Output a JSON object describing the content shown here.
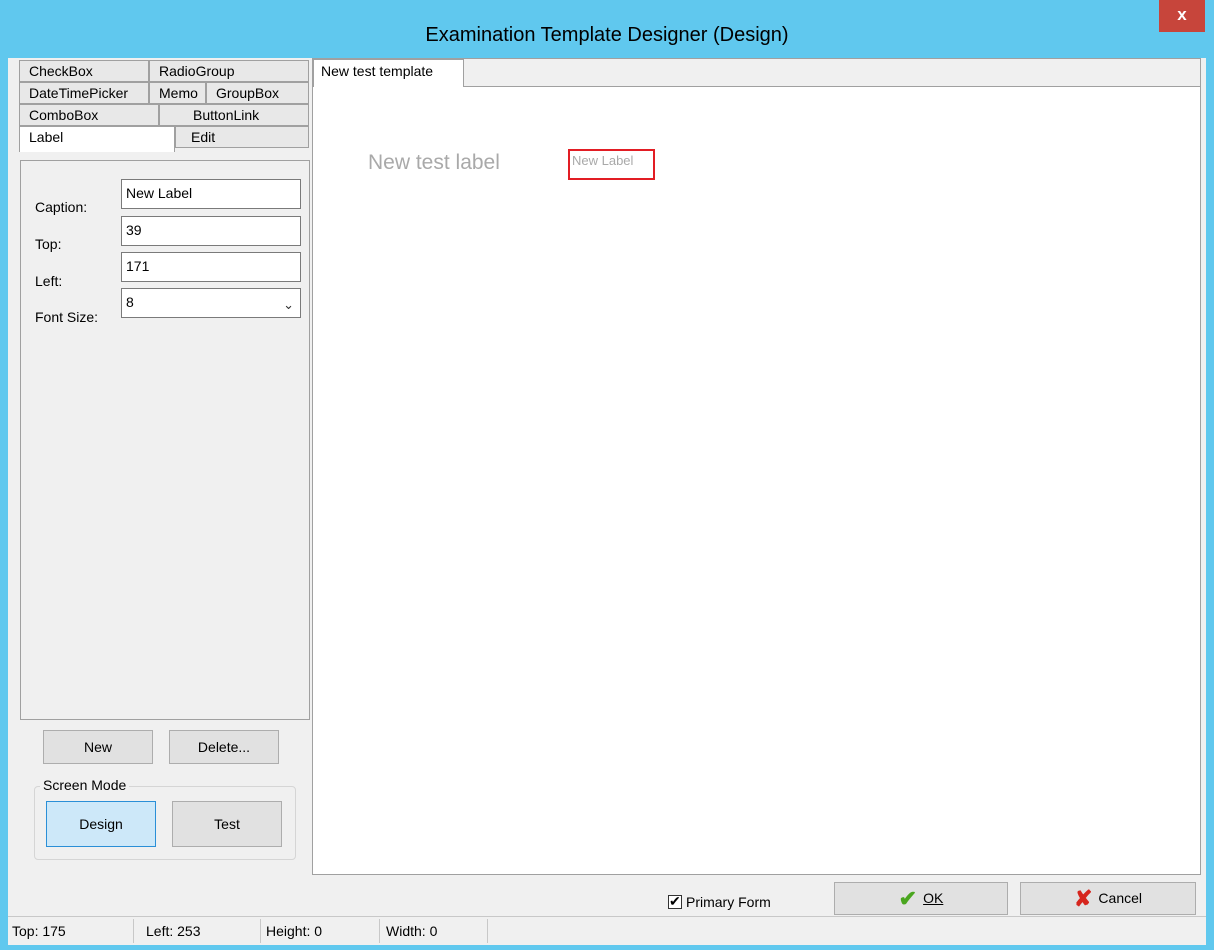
{
  "window": {
    "title": "Examination Template Designer (Design)",
    "close_glyph": "x"
  },
  "palette_tabs": [
    "CheckBox",
    "RadioGroup",
    "DateTimePicker",
    "Memo",
    "GroupBox",
    "ComboBox",
    "ButtonLink",
    "Label",
    "Edit"
  ],
  "properties": {
    "caption_label": "Caption:",
    "caption_value": "New Label",
    "top_label": "Top:",
    "top_value": "39",
    "left_label": "Left:",
    "left_value": "171",
    "fontsize_label": "Font Size:",
    "fontsize_value": "8"
  },
  "buttons": {
    "new": "New",
    "delete": "Delete..."
  },
  "screen_mode": {
    "caption": "Screen Mode",
    "design": "Design",
    "test": "Test",
    "selected": "Design"
  },
  "designer": {
    "tab": "New test template",
    "canvas_label_text": "New test label",
    "selected_label_text": "New Label"
  },
  "footer": {
    "primary_form_label": "Primary Form",
    "primary_form_checked": true,
    "ok_label": "OK",
    "cancel_label": "Cancel"
  },
  "status": {
    "top": "Top: 175",
    "left": "Left: 253",
    "height": "Height: 0",
    "width": "Width: 0"
  },
  "colors": {
    "title_bar": "#60c8ee",
    "close_button": "#c7453b",
    "selection_outline": "#e21d24",
    "ok_icon": "#4aa61f",
    "cancel_icon": "#d6251d"
  },
  "icons": {
    "close": "close-icon",
    "ok": "checkmark-icon",
    "cancel": "cross-icon",
    "dropdown": "chevron-down-icon"
  }
}
